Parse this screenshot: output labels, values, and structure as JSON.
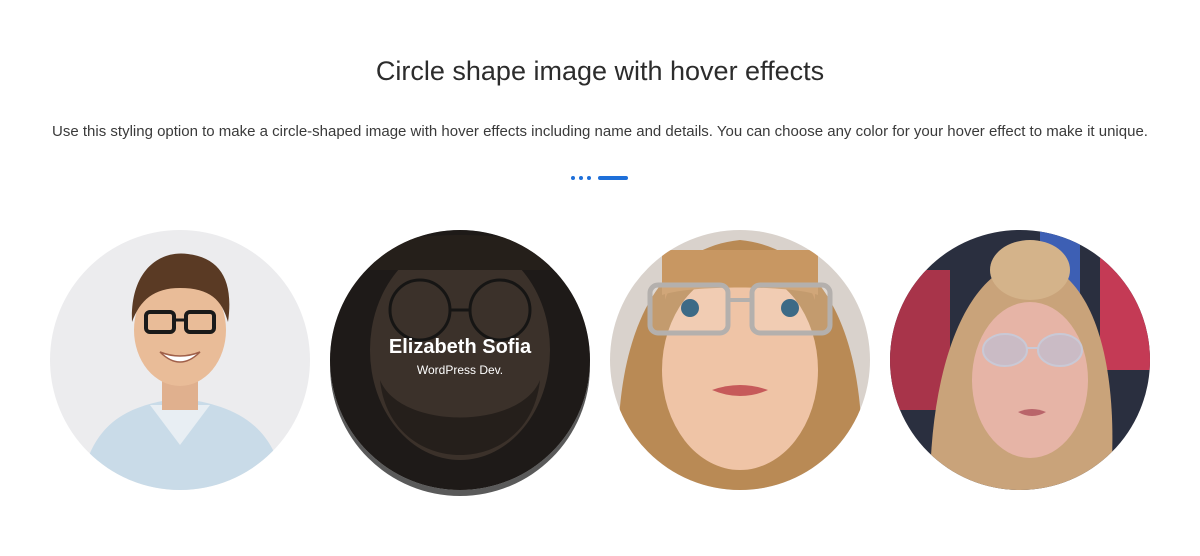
{
  "section": {
    "title": "Circle shape image with hover effects",
    "description": "Use this styling option to make a circle-shaped image with hover effects including name and details. You can choose any color for your hover effect to make it unique.",
    "accent_color": "#1e6fd9"
  },
  "cards": [
    {
      "image": "portrait-man-glasses-smiling",
      "hovered": false
    },
    {
      "image": "portrait-bearded-man-glasses",
      "hovered": true,
      "name": "Elizabeth Sofia",
      "role": "WordPress Dev."
    },
    {
      "image": "portrait-blonde-woman-glasses",
      "hovered": false
    },
    {
      "image": "portrait-woman-neon-lights-glasses",
      "hovered": false
    }
  ]
}
